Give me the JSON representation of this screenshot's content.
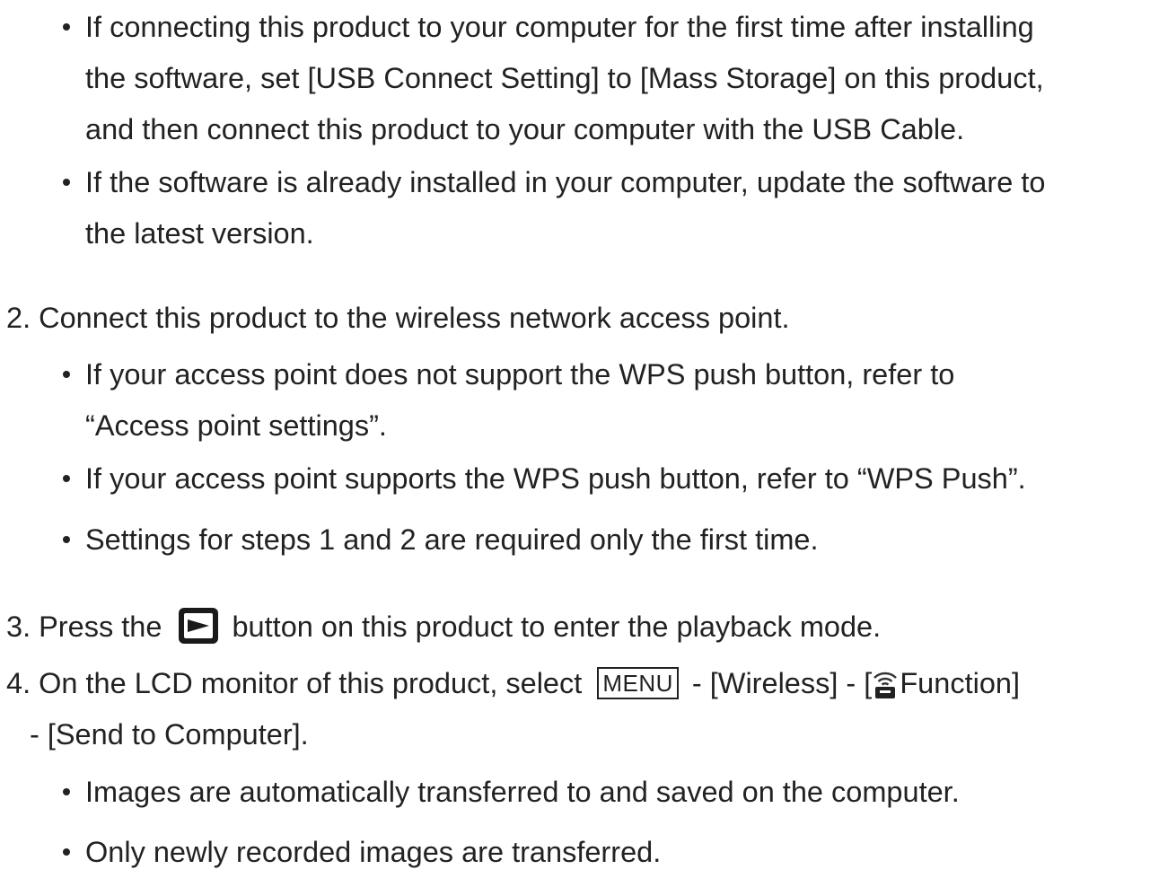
{
  "step1_bullets": {
    "b1_line1": "If connecting this product to your computer for the first time after installing",
    "b1_line2": "the software, set [USB Connect Setting] to [Mass Storage] on this product,",
    "b1_line3": "and then connect this product to your computer with the USB Cable.",
    "b2_line1": "If the software is already installed in your computer, update the software to",
    "b2_line2": "the latest version."
  },
  "step2": {
    "text": "2. Connect this product to the wireless network access point.",
    "b1_line1": "If your access point does not support the WPS push button, refer to",
    "b1_line2": "“Access point settings”.",
    "b2": "If your access point supports the WPS push button, refer to “WPS Push”.",
    "b3": "Settings for steps 1 and 2 are required only the first time."
  },
  "step3": {
    "before": "3. Press the",
    "icon": "playback-button-icon",
    "after": "button on this product to enter the playback mode."
  },
  "step4": {
    "before": "4. On the LCD monitor of this product, select",
    "menu_label": "MENU",
    "middle": "- [Wireless] - [",
    "icon": "wifi-function-icon",
    "after": "Function]",
    "line2": "- [Send to Computer].",
    "b1": "Images are automatically transferred to and saved on the computer.",
    "b2": "Only newly recorded images are transferred."
  },
  "colors": {
    "text": "#222222",
    "background": "#ffffff"
  }
}
